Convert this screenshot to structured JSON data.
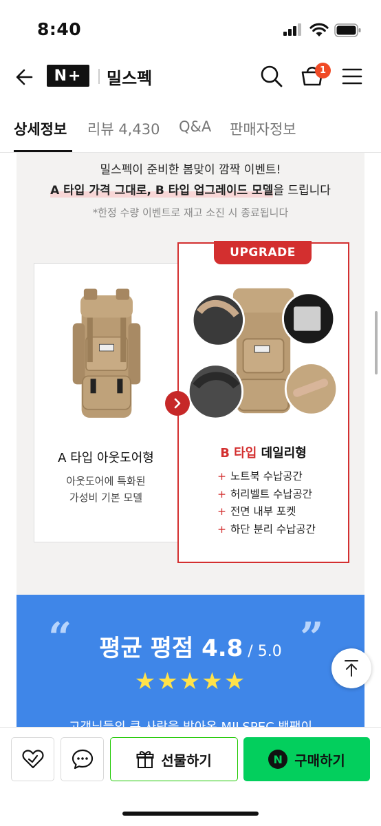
{
  "status_bar": {
    "time": "8:40"
  },
  "header": {
    "logo_text": "N+",
    "store_name": "밀스펙",
    "cart_count": "1"
  },
  "tabs": [
    {
      "label": "상세정보"
    },
    {
      "label": "리뷰 4,430"
    },
    {
      "label": "Q&A"
    },
    {
      "label": "판매자정보"
    }
  ],
  "promo": {
    "line1": "밀스펙이 준비한 봄맞이 깜짝 이벤트!",
    "line2_a": "A 타입 가격 그대로, B 타입 업그레이드 모델",
    "line2_b": "을 드립니다",
    "line3": "*한정 수량 이벤트로 재고 소진 시 종료됩니다"
  },
  "card_a": {
    "title": "A 타입 아웃도어형",
    "desc1": "아웃도어에 특화된",
    "desc2": "가성비 기본 모델"
  },
  "card_b": {
    "tag": "UPGRADE",
    "title_type": "B 타입",
    "title_rest": " 데일리형",
    "features": [
      "노트북 수납공간",
      "허리벨트 수납공간",
      "전면 내부 포켓",
      "하단 분리 수납공간"
    ]
  },
  "rating": {
    "title": "평균 평점 4.8",
    "out_of": " / 5.0",
    "stars": "★★★★★",
    "caption": "고객님들의 큰 사랑을 받아온 MILSPEC 백팩이"
  },
  "bottom_bar": {
    "gift_label": "선물하기",
    "buy_label": "구매하기",
    "npay_symbol": "N"
  },
  "colors": {
    "accent_red": "#d32f2f",
    "naver_green": "#03cf5d",
    "rating_blue": "#3f86e8",
    "badge_orange": "#f04a26"
  }
}
